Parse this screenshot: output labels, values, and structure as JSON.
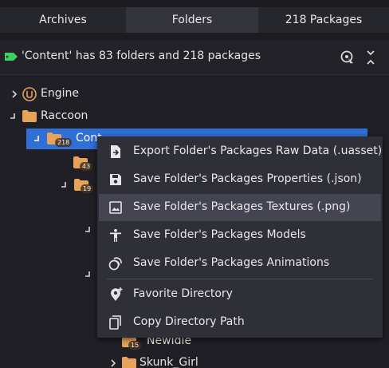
{
  "tabs": [
    "Archives",
    "Folders",
    "218 Packages"
  ],
  "status": {
    "text": "'Content' has 83 folders and 218 packages"
  },
  "tree": {
    "engine": "Engine",
    "raccoon": "Raccoon",
    "content": {
      "label": "Cont",
      "count": "218"
    },
    "badge_43": "43",
    "badge_19": "19",
    "newidle": {
      "label": "NewIdle",
      "count": "15"
    },
    "skunk": "Skunk_Girl"
  },
  "menu": [
    "Export Folder's Packages Raw Data (.uasset)",
    "Save Folder's Packages Properties (.json)",
    "Save Folder's Packages Textures (.png)",
    "Save Folder's Packages Models",
    "Save Folder's Packages Animations",
    "Favorite Directory",
    "Copy Directory Path"
  ],
  "colors": {
    "selection": "#2f6fd6",
    "folder": "#e8a35a",
    "tag": "#3ecf5e"
  }
}
